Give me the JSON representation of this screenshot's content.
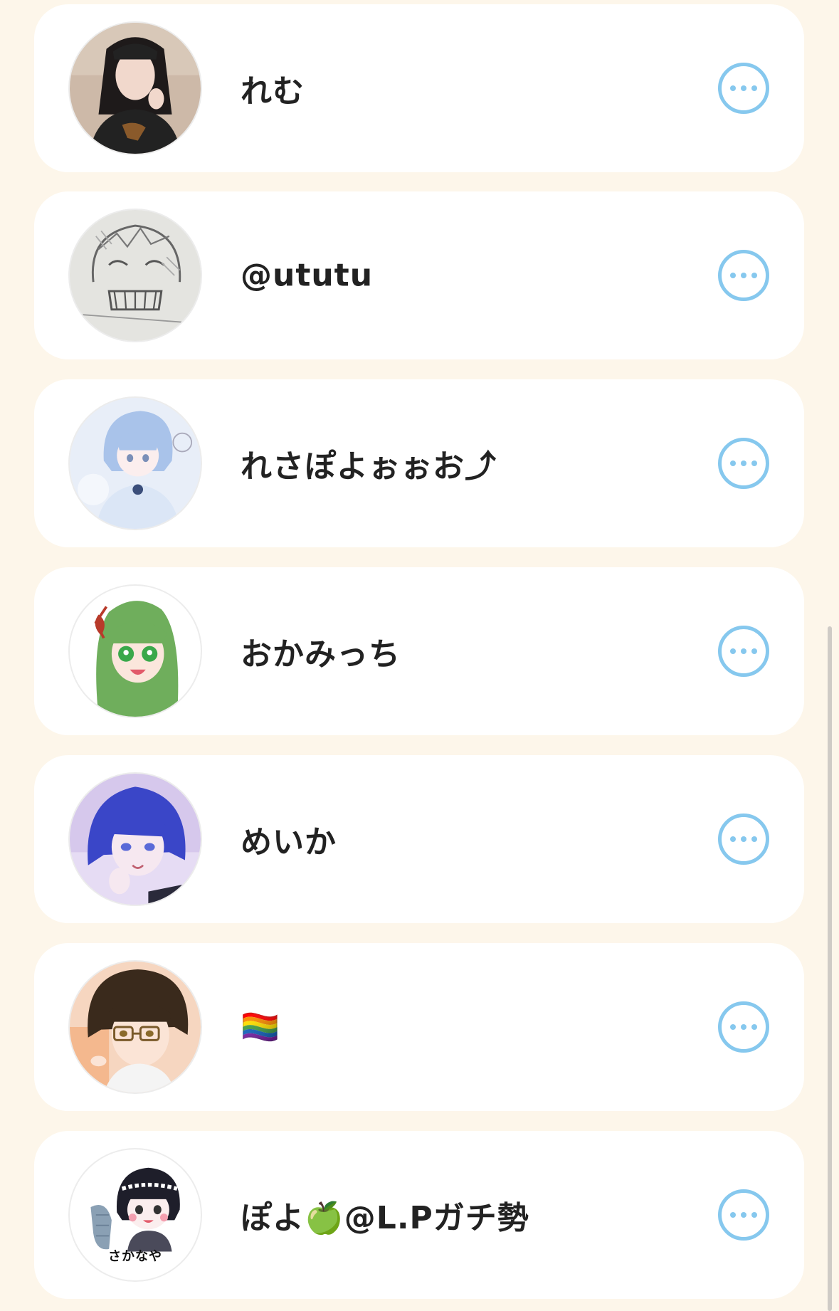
{
  "contacts": [
    {
      "name": "れむ",
      "avatar": "photo-girl-black-hair"
    },
    {
      "name": "@ututu",
      "avatar": "pencil-sketch-character"
    },
    {
      "name": "れさぽよぉぉお⤴",
      "avatar": "anime-blue-hair-pastel"
    },
    {
      "name": "おかみっち",
      "avatar": "anime-green-hair"
    },
    {
      "name": "めいか",
      "avatar": "anime-blue-hair-purple-bg"
    },
    {
      "name": "🏳️‍🌈",
      "avatar": "anime-brown-hair-glasses"
    },
    {
      "name": "ぽよ🍏@L.Pガチ勢",
      "avatar": "chibi-fish-sakanaya"
    }
  ],
  "avatar_texts": {
    "sakanaya": "さかなや"
  },
  "colors": {
    "background": "#fdf6ea",
    "card": "#ffffff",
    "accent": "#86c8ee",
    "text": "#222222"
  },
  "icons": {
    "more": "more-options-icon"
  }
}
